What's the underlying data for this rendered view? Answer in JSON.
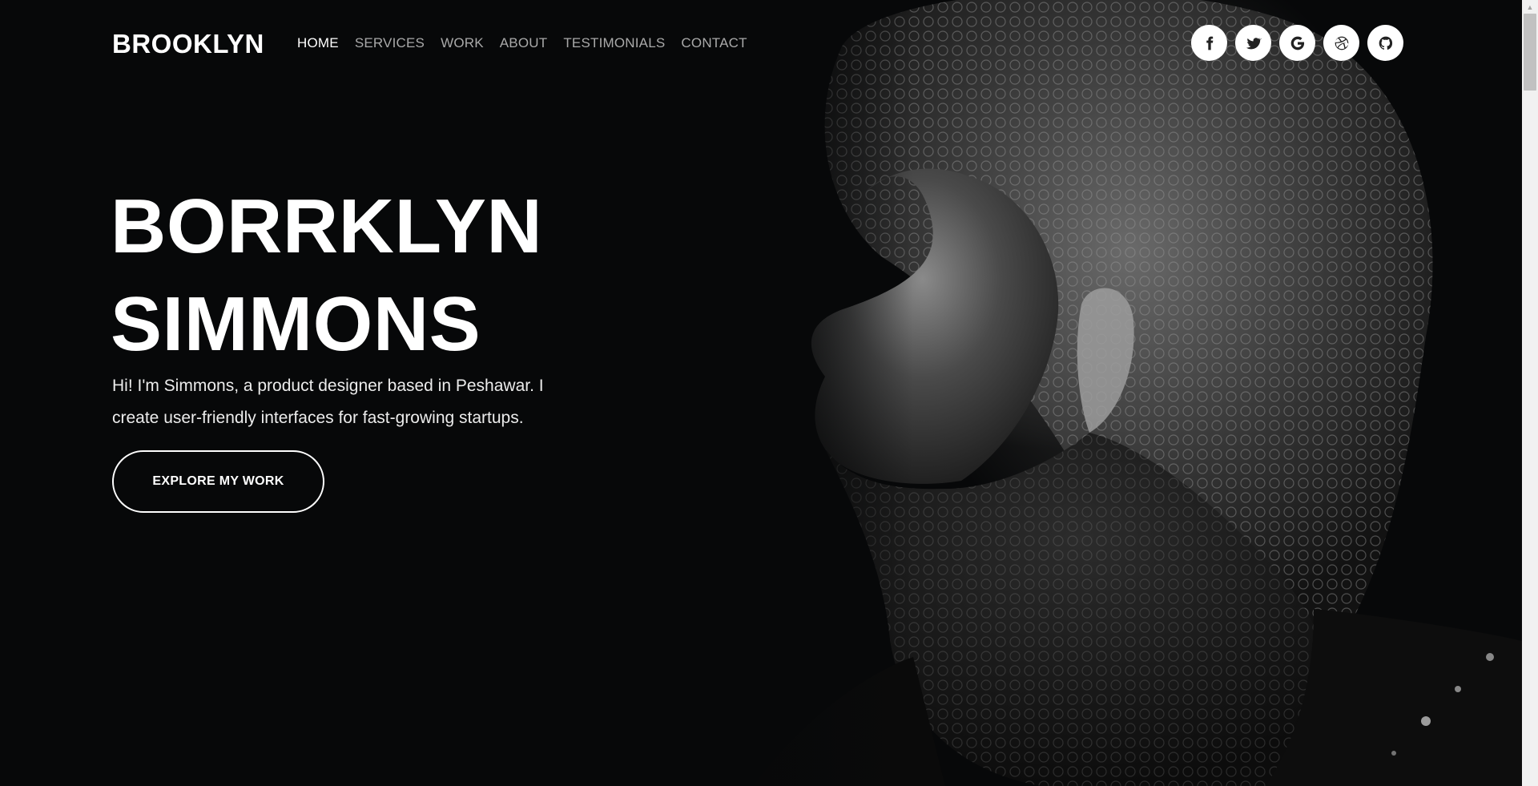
{
  "brand": {
    "name": "BROOKLYN"
  },
  "nav": {
    "items": [
      {
        "label": "HOME",
        "active": true
      },
      {
        "label": "SERVICES",
        "active": false
      },
      {
        "label": "WORK",
        "active": false
      },
      {
        "label": "ABOUT",
        "active": false
      },
      {
        "label": "TESTIMONIALS",
        "active": false
      },
      {
        "label": "CONTACT",
        "active": false
      }
    ]
  },
  "social": {
    "icons": [
      "facebook-icon",
      "twitter-icon",
      "google-icon",
      "dribbble-icon",
      "github-icon"
    ]
  },
  "hero": {
    "title_line1": "BORRKLYN",
    "title_line2": "SIMMONS",
    "description": "Hi! I'm Simmons, a product designer based in Peshawar. I create user-friendly interfaces for fast-growing startups.",
    "cta_label": "EXPLORE MY WORK"
  },
  "colors": {
    "background": "#070809",
    "text": "#ffffff",
    "nav_inactive": "#a9a9a9",
    "accent": "#ffffff"
  }
}
